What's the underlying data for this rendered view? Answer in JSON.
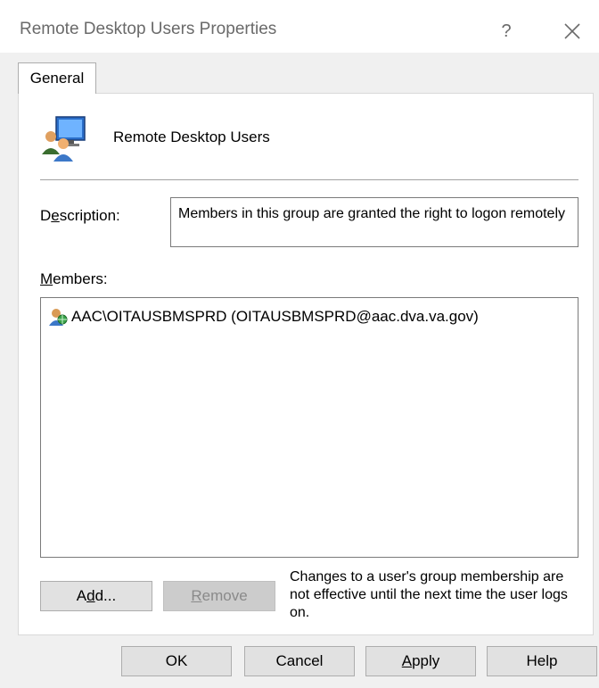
{
  "window": {
    "title": "Remote Desktop Users Properties",
    "help_glyph": "?",
    "close_icon": "close-icon"
  },
  "tabs": [
    {
      "label": "General",
      "selected": true
    }
  ],
  "group": {
    "icon": "user-group-icon",
    "name": "Remote Desktop Users"
  },
  "description": {
    "label_pre": "D",
    "label_mnemonic": "e",
    "label_post": "scription:",
    "value": "Members in this group are granted the right to logon remotely"
  },
  "members": {
    "label_mnemonic": "M",
    "label_post": "embers:",
    "items": [
      {
        "icon": "domain-user-icon",
        "text": "AAC\\OITAUSBMSPRD (OITAUSBMSPRD@aac.dva.va.gov)"
      }
    ]
  },
  "buttons": {
    "add_pre": "A",
    "add_mnemonic": "d",
    "add_post": "d...",
    "remove_mnemonic": "R",
    "remove_post": "emove",
    "ok": "OK",
    "cancel": "Cancel",
    "apply_mnemonic": "A",
    "apply_post": "pply",
    "help": "Help"
  },
  "note": "Changes to a user's group membership are not effective until the next time the user logs on.",
  "colors": {
    "background": "#f0f0f0",
    "panel": "#ffffff",
    "button": "#e1e1e1",
    "disabled_button": "#cccccc"
  }
}
